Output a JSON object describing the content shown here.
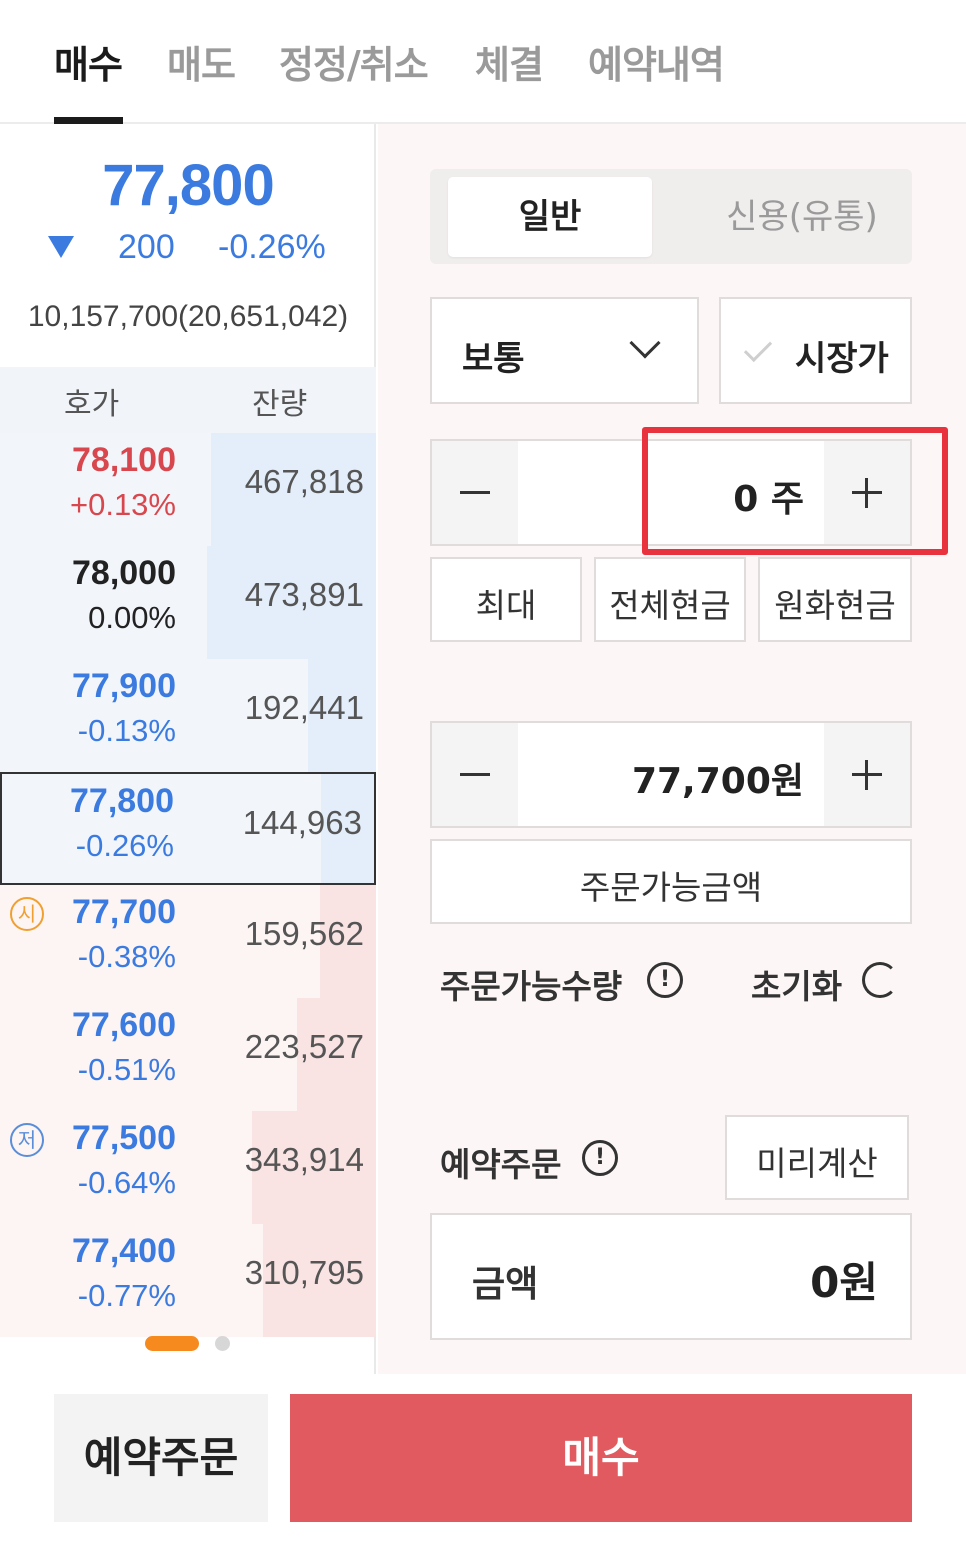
{
  "tabs": [
    {
      "label": "매수"
    },
    {
      "label": "매도"
    },
    {
      "label": "정정/취소"
    },
    {
      "label": "체결"
    },
    {
      "label": "예약내역"
    }
  ],
  "quote": {
    "price": "77,800",
    "change": "200",
    "change_pct": "-0.26%",
    "volume": "10,157,700(20,651,042)"
  },
  "orderbook": {
    "header_price": "호가",
    "header_qty": "잔량",
    "rows": [
      {
        "price": "78,100",
        "pct": "+0.13%",
        "qty": "467,818",
        "side": "sell",
        "color": "#d8474e",
        "depth": 0.44
      },
      {
        "price": "78,000",
        "pct": "0.00%",
        "qty": "473,891",
        "side": "sell",
        "color": "#222222",
        "depth": 0.45
      },
      {
        "price": "77,900",
        "pct": "-0.13%",
        "qty": "192,441",
        "side": "sell",
        "color": "#3b7be0",
        "depth": 0.18
      },
      {
        "price": "77,800",
        "pct": "-0.26%",
        "qty": "144,963",
        "side": "sell",
        "color": "#3b7be0",
        "depth": 0.14
      },
      {
        "price": "77,700",
        "pct": "-0.38%",
        "qty": "159,562",
        "side": "buy",
        "color": "#3b7be0",
        "depth": 0.15,
        "badge": "시"
      },
      {
        "price": "77,600",
        "pct": "-0.51%",
        "qty": "223,527",
        "side": "buy",
        "color": "#3b7be0",
        "depth": 0.21
      },
      {
        "price": "77,500",
        "pct": "-0.64%",
        "qty": "343,914",
        "side": "buy",
        "color": "#3b7be0",
        "depth": 0.33,
        "badge": "저"
      },
      {
        "price": "77,400",
        "pct": "-0.77%",
        "qty": "310,795",
        "side": "buy",
        "color": "#3b7be0",
        "depth": 0.3
      }
    ]
  },
  "order": {
    "segment_general": "일반",
    "segment_credit": "신용(유통)",
    "order_type": "보통",
    "market_price": "시장가",
    "quantity": "0 주",
    "max": "최대",
    "all_cash": "전체현금",
    "krw_cash": "원화현금",
    "price": "77,700원",
    "available_amount": "주문가능금액",
    "available_qty": "주문가능수량",
    "reset": "초기화",
    "reserve_order": "예약주문",
    "precalc": "미리계산",
    "amount_label": "금액",
    "amount_value": "0원"
  },
  "bottom": {
    "reserve_button": "예약주문",
    "buy_button": "매수"
  },
  "colors": {
    "blue": "#3b7be0",
    "red": "#d8474e",
    "buy_button": "#e15a60",
    "highlight": "#e8323e"
  }
}
